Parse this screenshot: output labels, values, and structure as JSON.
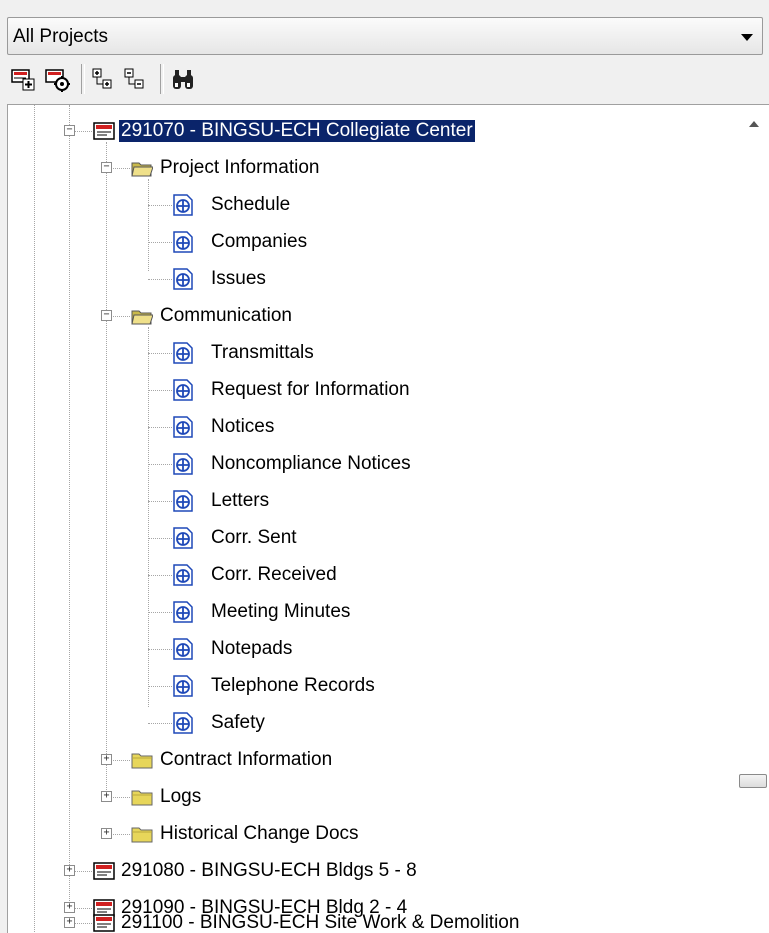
{
  "project_selector": {
    "value": "All Projects"
  },
  "toolbar": {
    "buttons": [
      "new-item-icon",
      "item-settings-icon",
      "expand-all-icon",
      "collapse-all-icon",
      "find-icon"
    ]
  },
  "tree": {
    "selected_project": {
      "label": "291070 - BINGSU-ECH Collegiate Center",
      "folders": {
        "project_information": {
          "label": "Project Information",
          "items": [
            "Schedule",
            "Companies",
            "Issues"
          ]
        },
        "communication": {
          "label": "Communication",
          "items": [
            "Transmittals",
            "Request for Information",
            "Notices",
            "Noncompliance Notices",
            "Letters",
            "Corr. Sent",
            "Corr. Received",
            "Meeting Minutes",
            "Notepads",
            "Telephone Records",
            "Safety"
          ]
        },
        "contract_information": {
          "label": "Contract Information"
        },
        "logs": {
          "label": "Logs"
        },
        "historical_change_docs": {
          "label": "Historical Change Docs"
        }
      }
    },
    "other_projects": [
      "291080 - BINGSU-ECH Bldgs 5 - 8",
      "291090 - BINGSU-ECH Bldg 2 - 4",
      "291100 - BINGSU-ECH Site Work & Demolition"
    ]
  },
  "colors": {
    "selection": "#0a246a",
    "folder": "#e7d65a",
    "doc_icon": "#1f49b8"
  }
}
